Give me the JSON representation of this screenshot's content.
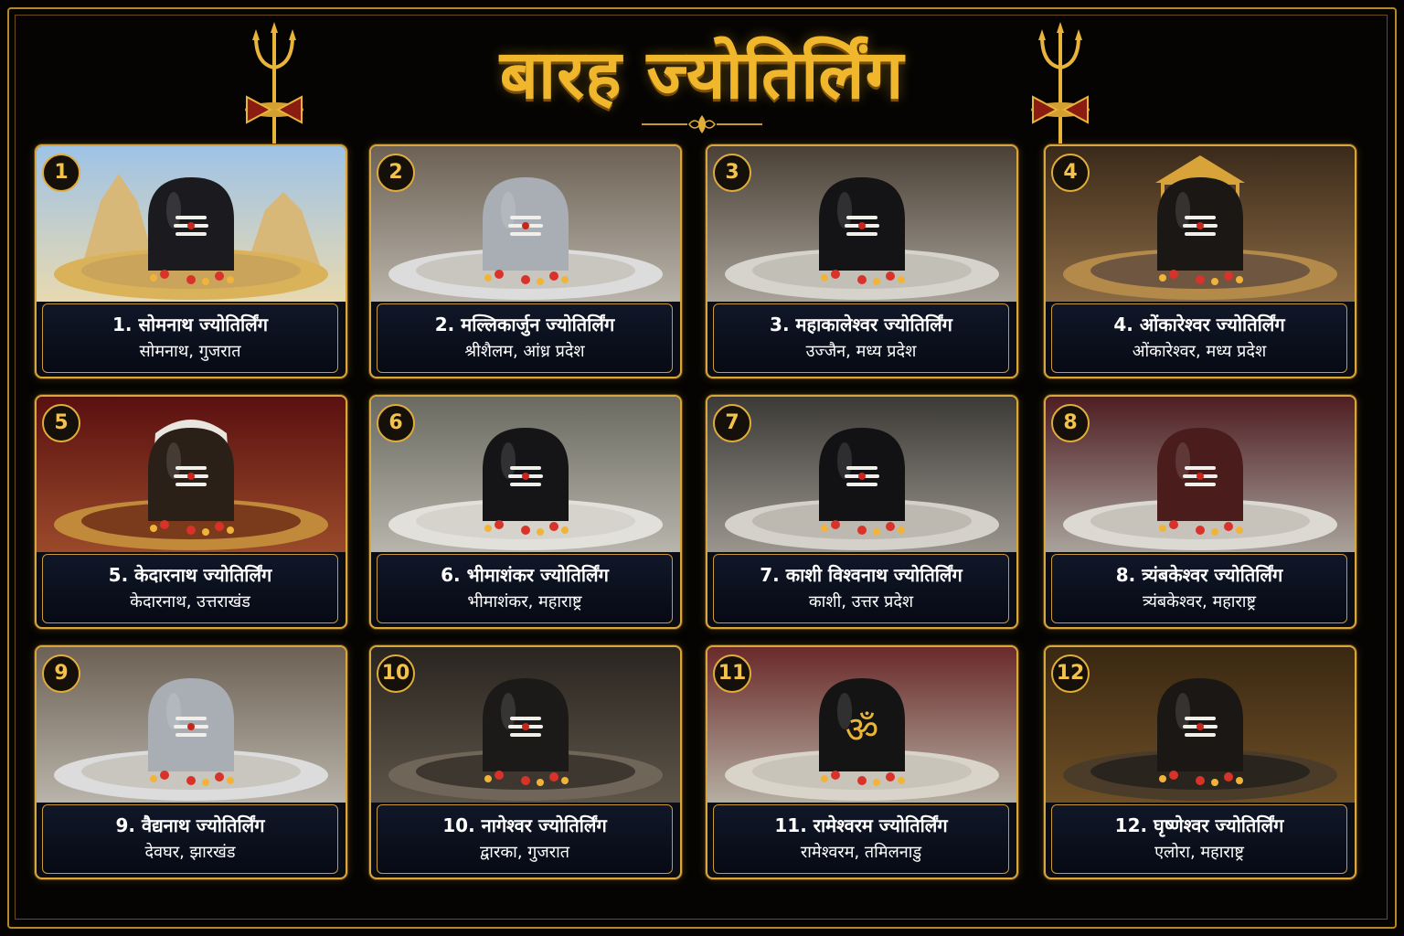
{
  "title": "बारह ज्योतिर्लिंग",
  "colors": {
    "gold": "#e0ad3c",
    "title": "#f0b62c",
    "caption_bg": "#0b1122",
    "background": "#050403"
  },
  "cards": [
    {
      "number": "1",
      "name": "1. सोमनाथ ज्योतिर्लिंग",
      "location": "सोमनाथ, गुजरात",
      "scene": "temple-sky"
    },
    {
      "number": "2",
      "name": "2. मल्लिकार्जुन ज्योतिर्लिंग",
      "location": "श्रीशैलम, आंध्र प्रदेश",
      "scene": "silver-linga"
    },
    {
      "number": "3",
      "name": "3. महाकालेश्वर ज्योतिर्लिंग",
      "location": "उज्जैन, मध्य प्रदेश",
      "scene": "black-linga"
    },
    {
      "number": "4",
      "name": "4. ओंकारेश्वर ज्योतिर्लिंग",
      "location": "ओंकारेश्वर, मध्य प्रदेश",
      "scene": "golden-canopy"
    },
    {
      "number": "5",
      "name": "5. केदारनाथ ज्योतिर्लिंग",
      "location": "केदारनाथ, उत्तराखंड",
      "scene": "decorated-face"
    },
    {
      "number": "6",
      "name": "6. भीमाशंकर ज्योतिर्लिंग",
      "location": "भीमाशंकर, महाराष्ट्र",
      "scene": "silver-basin"
    },
    {
      "number": "7",
      "name": "7. काशी विश्वनाथ ज्योतिर्लिंग",
      "location": "काशी, उत्तर प्रदेश",
      "scene": "silver-basin-dark"
    },
    {
      "number": "8",
      "name": "8. त्र्यंबकेश्वर ज्योतिर्लिंग",
      "location": "त्र्यंबकेश्वर, महाराष्ट्र",
      "scene": "flower-mound"
    },
    {
      "number": "9",
      "name": "9. वैद्यनाथ ज्योतिर्लिंग",
      "location": "देवघर, झारखंड",
      "scene": "silver-linga"
    },
    {
      "number": "10",
      "name": "10. नागेश्वर ज्योतिर्लिंग",
      "location": "द्वारका, गुजरात",
      "scene": "dark-stone"
    },
    {
      "number": "11",
      "name": "11. रामेश्वरम ज्योतिर्लिंग",
      "location": "रामेश्वरम, तमिलनाडु",
      "scene": "om-linga"
    },
    {
      "number": "12",
      "name": "12. घृष्णेश्वर ज्योतिर्लिंग",
      "location": "एलोरा, महाराष्ट्र",
      "scene": "cave"
    }
  ]
}
